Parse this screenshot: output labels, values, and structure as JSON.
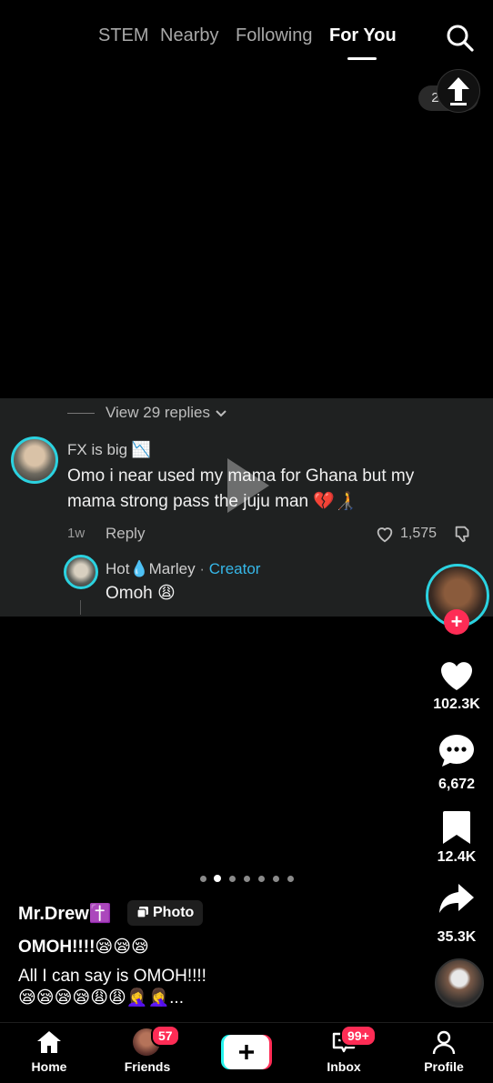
{
  "top_nav": {
    "tabs": [
      {
        "label": "STEM"
      },
      {
        "label": "Nearby"
      },
      {
        "label": "Following"
      },
      {
        "label": "For You"
      }
    ]
  },
  "page_indicator": "2 / 15",
  "comment": {
    "view_replies": "View 29 replies",
    "username": "FX is big 📉",
    "text": "Omo i near used my mama for Ghana but my mama strong pass the juju man 💔🧑‍🦯",
    "time": "1w",
    "reply_label": "Reply",
    "like_count": "1,575",
    "reply": {
      "username": "Hot💧Marley",
      "separator": " · ",
      "creator_label": "Creator",
      "text": "Omoh 😩"
    }
  },
  "rail": {
    "likes": "102.3K",
    "comments": "6,672",
    "saves": "12.4K",
    "shares": "35.3K"
  },
  "carousel": {
    "total": 7,
    "active": 1
  },
  "post": {
    "author": "Mr.Drew✝️",
    "photo_badge": "Photo",
    "title": "OMOH!!!!😪😪😪",
    "description_line1": "All I can say is OMOH!!!!",
    "description_line2": "😪😪😪😪😩😩🤦‍♀️🤦‍♀️..."
  },
  "bottom_nav": {
    "home": "Home",
    "friends": "Friends",
    "friends_badge": "57",
    "inbox": "Inbox",
    "inbox_badge": "99+",
    "profile": "Profile"
  }
}
